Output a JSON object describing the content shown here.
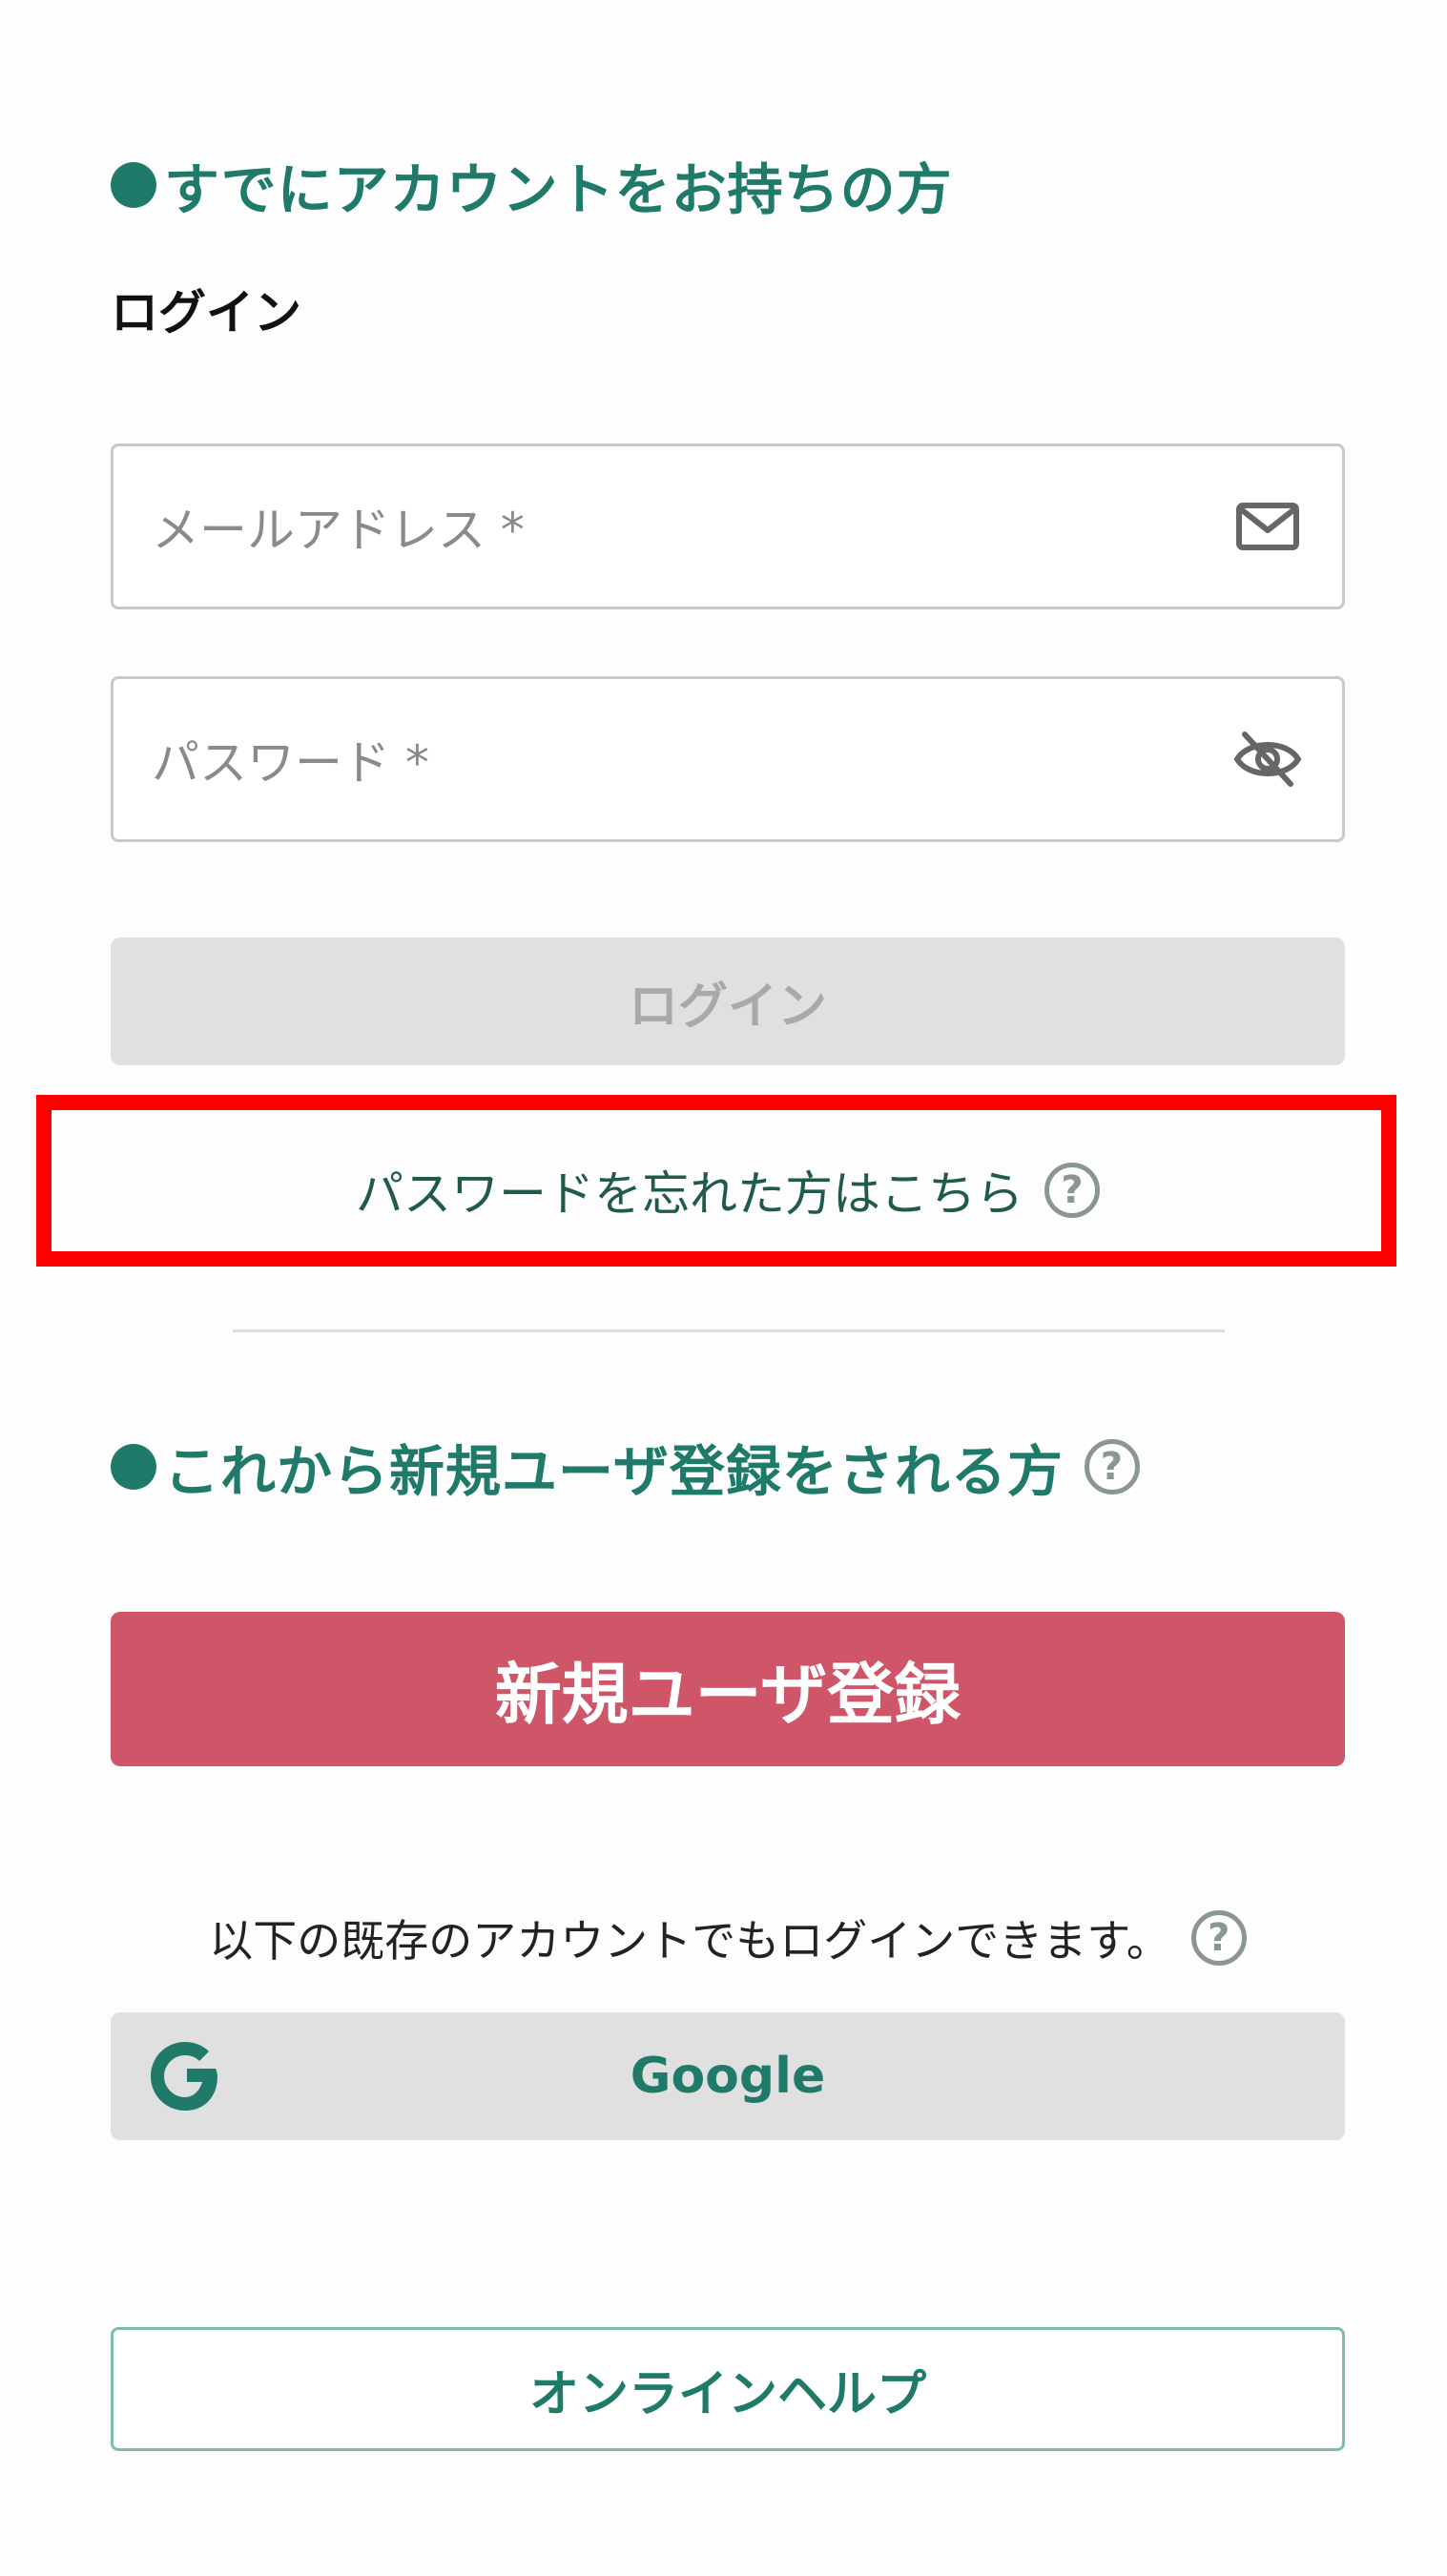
{
  "login_section": {
    "heading": "すでにアカウントをお持ちの方",
    "subheading": "ログイン",
    "email_placeholder": "メールアドレス *",
    "password_placeholder": "パスワード *",
    "login_button": "ログイン",
    "forgot_password_link": "パスワードを忘れた方はこちら",
    "help_glyph": "?"
  },
  "register_section": {
    "heading": "これから新規ユーザ登録をされる方",
    "help_glyph": "?",
    "register_button": "新規ユーザ登録"
  },
  "social_login": {
    "text": "以下の既存のアカウントでもログインできます。",
    "help_glyph": "?",
    "google_button": "Google"
  },
  "footer": {
    "online_help_button": "オンラインヘルプ"
  },
  "colors": {
    "accent_green": "#1f7a6a",
    "register_red": "#cf5568",
    "disabled_gray": "#e0e0e0",
    "highlight_red": "#ff0000"
  },
  "icons": {
    "email": "mail-icon",
    "password": "eye-off-icon",
    "help": "question-circle-icon",
    "google": "google-g-icon"
  }
}
